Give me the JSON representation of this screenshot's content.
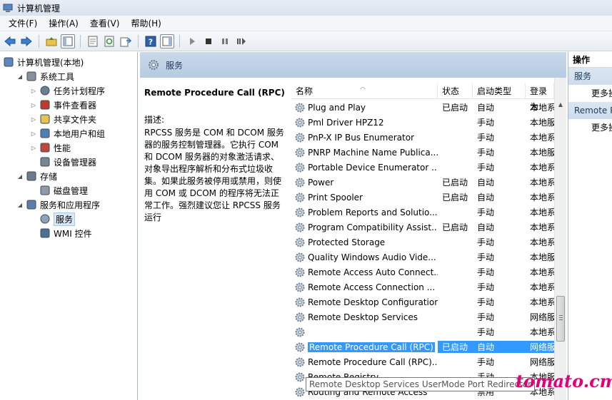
{
  "window": {
    "title": "计算机管理"
  },
  "menu": [
    "文件(F)",
    "操作(A)",
    "查看(V)",
    "帮助(H)"
  ],
  "tree": [
    {
      "label": "计算机管理(本地)",
      "level": 0,
      "arrow": "",
      "icon": "computer-icon"
    },
    {
      "label": "系统工具",
      "level": 1,
      "arrow": "◢",
      "icon": "tools-icon"
    },
    {
      "label": "任务计划程序",
      "level": 2,
      "arrow": "▷",
      "icon": "clock-icon"
    },
    {
      "label": "事件查看器",
      "level": 2,
      "arrow": "▷",
      "icon": "event-icon"
    },
    {
      "label": "共享文件夹",
      "level": 2,
      "arrow": "▷",
      "icon": "folder-icon"
    },
    {
      "label": "本地用户和组",
      "level": 2,
      "arrow": "▷",
      "icon": "users-icon"
    },
    {
      "label": "性能",
      "level": 2,
      "arrow": "▷",
      "icon": "performance-icon"
    },
    {
      "label": "设备管理器",
      "level": 2,
      "arrow": "",
      "icon": "device-icon"
    },
    {
      "label": "存储",
      "level": 1,
      "arrow": "◢",
      "icon": "storage-icon"
    },
    {
      "label": "磁盘管理",
      "level": 2,
      "arrow": "",
      "icon": "disk-icon"
    },
    {
      "label": "服务和应用程序",
      "level": 1,
      "arrow": "◢",
      "icon": "apps-icon"
    },
    {
      "label": "服务",
      "level": 2,
      "arrow": "",
      "icon": "services-icon",
      "selected": true
    },
    {
      "label": "WMI 控件",
      "level": 2,
      "arrow": "",
      "icon": "wmi-icon"
    }
  ],
  "middle": {
    "header": "服务",
    "desc_title": "Remote Procedure Call (RPC)",
    "desc_label": "描述:",
    "desc_text": "RPCSS 服务是 COM 和 DCOM 服务器的服务控制管理器。它执行 COM 和 DCOM 服务器的对象激活请求、对象导出程序解析和分布式垃圾收集。如果此服务被停用或禁用，则使用 COM 或 DCOM 的程序将无法正常工作。强烈建议您让 RPCSS 服务运行"
  },
  "columns": {
    "name": "名称",
    "status": "状态",
    "startup": "启动类型",
    "logon": "登录为"
  },
  "services": [
    {
      "name": "Plug and Play",
      "status": "已启动",
      "startup": "自动",
      "logon": "本地系"
    },
    {
      "name": "Pml Driver HPZ12",
      "status": "",
      "startup": "手动",
      "logon": "本地服"
    },
    {
      "name": "PnP-X IP Bus Enumerator",
      "status": "",
      "startup": "手动",
      "logon": "本地系"
    },
    {
      "name": "PNRP Machine Name Publica...",
      "status": "",
      "startup": "手动",
      "logon": "本地服"
    },
    {
      "name": "Portable Device Enumerator ...",
      "status": "",
      "startup": "手动",
      "logon": "本地系"
    },
    {
      "name": "Power",
      "status": "已启动",
      "startup": "自动",
      "logon": "本地系"
    },
    {
      "name": "Print Spooler",
      "status": "已启动",
      "startup": "自动",
      "logon": "本地系"
    },
    {
      "name": "Problem Reports and Solutio...",
      "status": "",
      "startup": "手动",
      "logon": "本地系"
    },
    {
      "name": "Program Compatibility Assist...",
      "status": "已启动",
      "startup": "自动",
      "logon": "本地系"
    },
    {
      "name": "Protected Storage",
      "status": "",
      "startup": "手动",
      "logon": "本地系"
    },
    {
      "name": "Quality Windows Audio Vide...",
      "status": "",
      "startup": "手动",
      "logon": "本地服"
    },
    {
      "name": "Remote Access Auto Connect...",
      "status": "",
      "startup": "手动",
      "logon": "本地系"
    },
    {
      "name": "Remote Access Connection ...",
      "status": "",
      "startup": "手动",
      "logon": "本地系"
    },
    {
      "name": "Remote Desktop Configuration",
      "status": "",
      "startup": "手动",
      "logon": "本地系"
    },
    {
      "name": "Remote Desktop Services",
      "status": "",
      "startup": "手动",
      "logon": "网络服"
    },
    {
      "name": "",
      "status": "",
      "startup": "手动",
      "logon": "本地系"
    },
    {
      "name": "Remote Procedure Call (RPC)",
      "status": "已启动",
      "startup": "自动",
      "logon": "网络服",
      "selected": true
    },
    {
      "name": "Remote Procedure Call (RPC)...",
      "status": "",
      "startup": "手动",
      "logon": "网络服"
    },
    {
      "name": "Remote Registry",
      "status": "",
      "startup": "手动",
      "logon": "本地服"
    },
    {
      "name": "Routing and Remote Access",
      "status": "",
      "startup": "禁用",
      "logon": "本地系"
    }
  ],
  "tooltip": "Remote Desktop Services UserMode Port Redirector",
  "actions": {
    "head": "操作",
    "sections": [
      {
        "title": "服务",
        "item": "更多操作"
      },
      {
        "title": "Remote Procedure Call (RPC)",
        "item": "更多操作"
      }
    ]
  },
  "watermark": "tomato.cm",
  "colors": {
    "selection": "#3399ff",
    "header_band": "#b6cbe1",
    "watermark": "#e0007a"
  }
}
